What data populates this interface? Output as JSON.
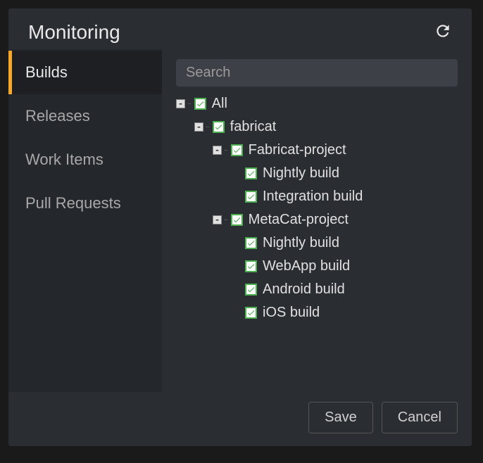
{
  "header": {
    "title": "Monitoring"
  },
  "sidebar": {
    "items": [
      {
        "label": "Builds",
        "active": true
      },
      {
        "label": "Releases",
        "active": false
      },
      {
        "label": "Work Items",
        "active": false
      },
      {
        "label": "Pull Requests",
        "active": false
      }
    ]
  },
  "search": {
    "placeholder": "Search",
    "value": ""
  },
  "tree": [
    {
      "indent": 0,
      "expandable": true,
      "expanded": true,
      "checked": true,
      "label": "All"
    },
    {
      "indent": 1,
      "expandable": true,
      "expanded": true,
      "checked": true,
      "label": "fabricat"
    },
    {
      "indent": 2,
      "expandable": true,
      "expanded": true,
      "checked": true,
      "label": "Fabricat-project"
    },
    {
      "indent": 3,
      "expandable": false,
      "checked": true,
      "label": "Nightly build"
    },
    {
      "indent": 3,
      "expandable": false,
      "checked": true,
      "label": "Integration build"
    },
    {
      "indent": 2,
      "expandable": true,
      "expanded": true,
      "checked": true,
      "label": "MetaCat-project"
    },
    {
      "indent": 3,
      "expandable": false,
      "checked": true,
      "label": "Nightly build"
    },
    {
      "indent": 3,
      "expandable": false,
      "checked": true,
      "label": "WebApp build"
    },
    {
      "indent": 3,
      "expandable": false,
      "checked": true,
      "label": "Android build"
    },
    {
      "indent": 3,
      "expandable": false,
      "checked": true,
      "label": "iOS build"
    }
  ],
  "footer": {
    "save_label": "Save",
    "cancel_label": "Cancel"
  },
  "colors": {
    "accent": "#f9a825",
    "checkbox": "#4caf50"
  }
}
